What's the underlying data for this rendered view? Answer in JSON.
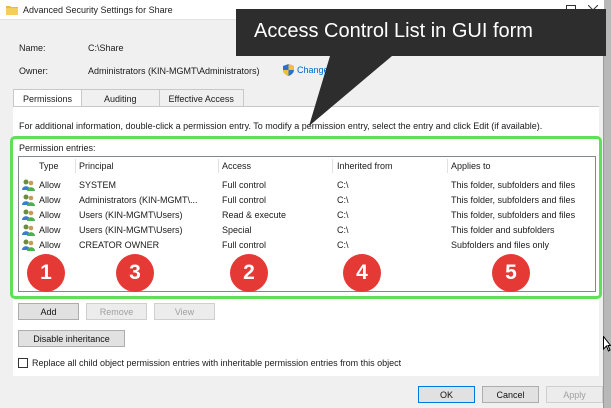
{
  "window": {
    "title": "Advanced Security Settings for Share"
  },
  "info": {
    "name_label": "Name:",
    "name_value": "C:\\Share",
    "owner_label": "Owner:",
    "owner_value": "Administrators (KIN-MGMT\\Administrators)",
    "change_link": "Change"
  },
  "tabs": [
    {
      "label": "Permissions",
      "active": true
    },
    {
      "label": "Auditing",
      "active": false
    },
    {
      "label": "Effective Access",
      "active": false
    }
  ],
  "instructions": "For additional information, double-click a permission entry. To modify a permission entry, select the entry and click Edit (if available).",
  "permissions": {
    "caption": "Permission entries:",
    "columns": [
      "Type",
      "Principal",
      "Access",
      "Inherited from",
      "Applies to"
    ],
    "rows": [
      {
        "type": "Allow",
        "principal": "SYSTEM",
        "access": "Full control",
        "inherited": "C:\\",
        "applies": "This folder, subfolders and files"
      },
      {
        "type": "Allow",
        "principal": "Administrators (KIN-MGMT\\...",
        "access": "Full control",
        "inherited": "C:\\",
        "applies": "This folder, subfolders and files"
      },
      {
        "type": "Allow",
        "principal": "Users (KIN-MGMT\\Users)",
        "access": "Read & execute",
        "inherited": "C:\\",
        "applies": "This folder, subfolders and files"
      },
      {
        "type": "Allow",
        "principal": "Users (KIN-MGMT\\Users)",
        "access": "Special",
        "inherited": "C:\\",
        "applies": "This folder and subfolders"
      },
      {
        "type": "Allow",
        "principal": "CREATOR OWNER",
        "access": "Full control",
        "inherited": "C:\\",
        "applies": "Subfolders and files only"
      }
    ]
  },
  "buttons": {
    "add": "Add",
    "remove": "Remove",
    "view": "View",
    "disable_inheritance": "Disable inheritance",
    "ok": "OK",
    "cancel": "Cancel",
    "apply": "Apply"
  },
  "checkbox": {
    "label": "Replace all child object permission entries with inheritable permission entries from this object",
    "checked": false
  },
  "annotation": {
    "callout": "Access Control List in GUI form",
    "markers": [
      "1",
      "3",
      "2",
      "4",
      "5"
    ]
  },
  "colors": {
    "highlight_frame": "#5ee05a",
    "marker": "#e53935",
    "callout_bg": "#2d2d2d",
    "link": "#0066cc"
  },
  "icons": [
    "folder-icon",
    "minimize-icon",
    "maximize-icon",
    "close-icon",
    "shield-icon",
    "users-icon"
  ]
}
